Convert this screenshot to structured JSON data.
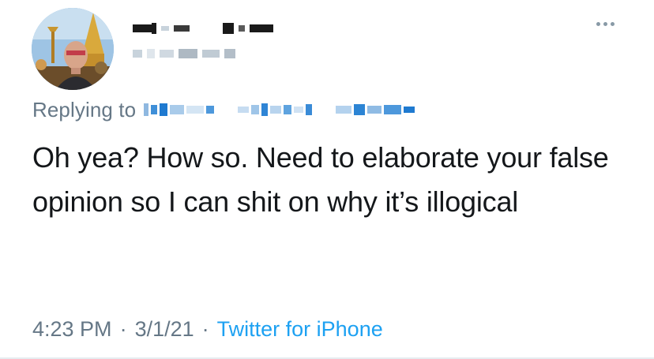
{
  "tweet": {
    "replying_label": "Replying to",
    "text": "Oh yea? How so. Need to elaborate your false opinion so I can shit on why it’s illogical",
    "time": "4:23 PM",
    "separator": "·",
    "date": "3/1/21",
    "source": "Twitter for iPhone"
  },
  "colors": {
    "text_primary": "#14171a",
    "text_secondary": "#657786",
    "link": "#1da1f2",
    "redaction_dark": "#1a1a1a",
    "redaction_light": "#c8d3dc"
  },
  "icons": {
    "more": "more-horizontal-icon",
    "avatar": "profile-avatar"
  }
}
